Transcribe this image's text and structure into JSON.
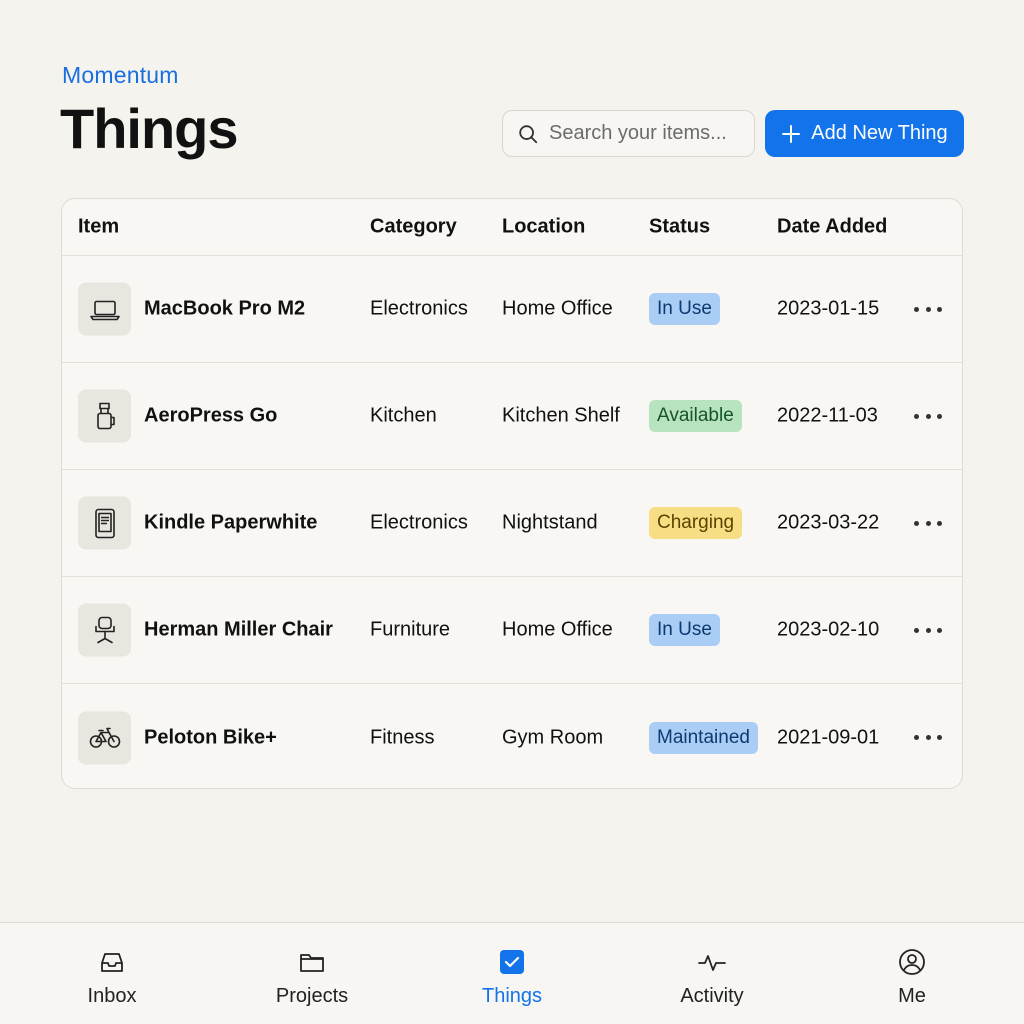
{
  "header": {
    "brand": "Momentum",
    "title": "Things",
    "search_placeholder": "Search your items...",
    "add_label": "Add New Thing"
  },
  "table": {
    "columns": [
      "Item",
      "Category",
      "Location",
      "Status",
      "Date Added"
    ],
    "rows": [
      {
        "icon": "laptop-icon",
        "name": "MacBook Pro M2",
        "category": "Electronics",
        "location": "Home Office",
        "status": "In Use",
        "status_color": "blue",
        "date": "2023-01-15"
      },
      {
        "icon": "coffee-press-icon",
        "name": "AeroPress Go",
        "category": "Kitchen",
        "location": "Kitchen Shelf",
        "status": "Available",
        "status_color": "green",
        "date": "2022-11-03"
      },
      {
        "icon": "ereader-icon",
        "name": "Kindle Paperwhite",
        "category": "Electronics",
        "location": "Nightstand",
        "status": "Charging",
        "status_color": "yellow",
        "date": "2023-03-22"
      },
      {
        "icon": "office-chair-icon",
        "name": "Herman Miller Chair",
        "category": "Furniture",
        "location": "Home Office",
        "status": "In Use",
        "status_color": "blue",
        "date": "2023-02-10"
      },
      {
        "icon": "bicycle-icon",
        "name": "Peloton Bike+",
        "category": "Fitness",
        "location": "Gym Room",
        "status": "Maintained",
        "status_color": "blue",
        "date": "2021-09-01"
      }
    ]
  },
  "nav": {
    "items": [
      {
        "label": "Inbox",
        "icon": "inbox-icon",
        "active": false
      },
      {
        "label": "Projects",
        "icon": "folder-icon",
        "active": false
      },
      {
        "label": "Things",
        "icon": "checkbox-icon",
        "active": true
      },
      {
        "label": "Activity",
        "icon": "activity-icon",
        "active": false
      },
      {
        "label": "Me",
        "icon": "user-circle-icon",
        "active": false
      }
    ]
  },
  "colors": {
    "accent": "#1273ea",
    "background": "#f5f3ee",
    "badge_blue": "#a9cdf5",
    "badge_green": "#b7e4be",
    "badge_yellow": "#f7de84"
  }
}
